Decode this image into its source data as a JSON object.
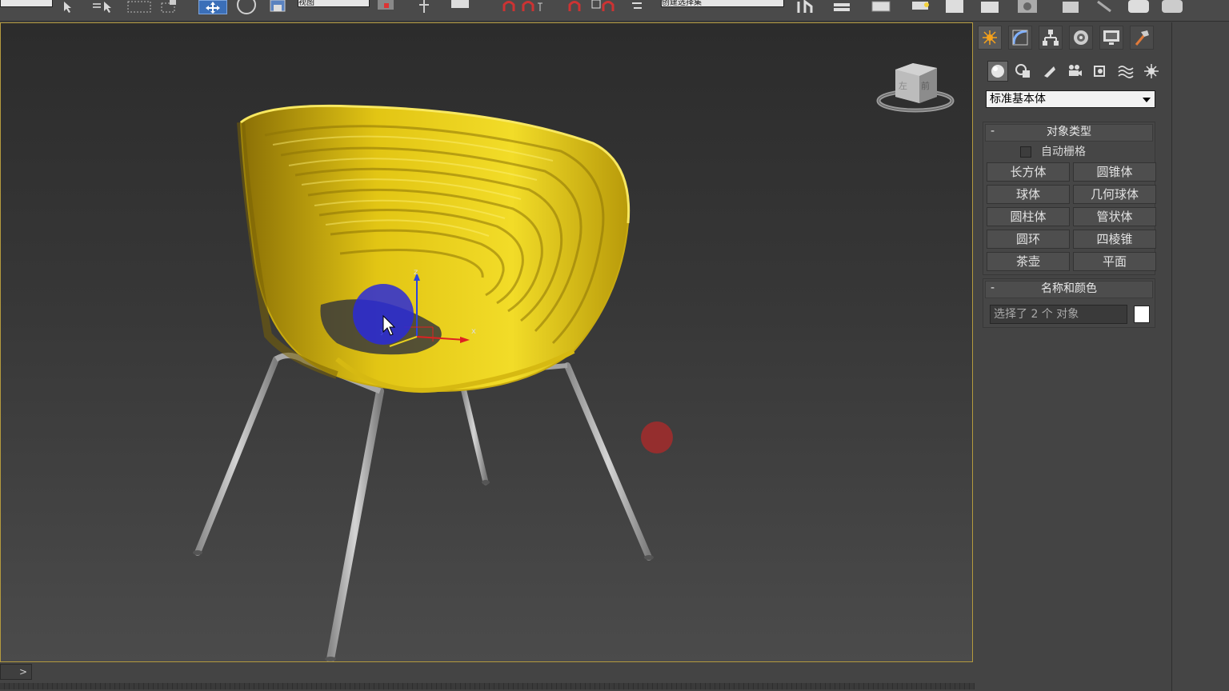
{
  "toolbar": {
    "selection_filter": "",
    "reference_coord": "视图",
    "named_selection": "创建选择集"
  },
  "viewport": {
    "viewcube_face_left": "左",
    "viewcube_face_front": "前",
    "gizmo_axis_x": "x",
    "gizmo_axis_y": "y",
    "gizmo_axis_z": "z"
  },
  "command_panel": {
    "tabs": [
      "create-icon",
      "modify-icon",
      "hierarchy-icon",
      "motion-icon",
      "display-icon",
      "utilities-icon"
    ],
    "subcategories": [
      "geometry-icon",
      "shapes-icon",
      "lights-icon",
      "cameras-icon",
      "helpers-icon",
      "spacewarps-icon",
      "systems-icon"
    ],
    "type_dropdown": "标准基本体",
    "object_type": {
      "minus": "-",
      "title": "对象类型",
      "autogrid_label": "自动栅格",
      "buttons": [
        "长方体",
        "圆锥体",
        "球体",
        "几何球体",
        "圆柱体",
        "管状体",
        "圆环",
        "四棱锥",
        "茶壶",
        "平面"
      ]
    },
    "name_color": {
      "minus": "-",
      "title": "名称和颜色",
      "name_value": "选择了 2 个 对象",
      "color": "#ffffff"
    }
  },
  "bottom": {
    "time_slider_arrow": ">"
  },
  "colors": {
    "chair_shell": "#e6c812",
    "chair_legs": "#b9b9b9",
    "viewport_border": "#b49a3e",
    "cursor_highlight": "#2a2ad8",
    "click_marker": "#a42c2c"
  }
}
